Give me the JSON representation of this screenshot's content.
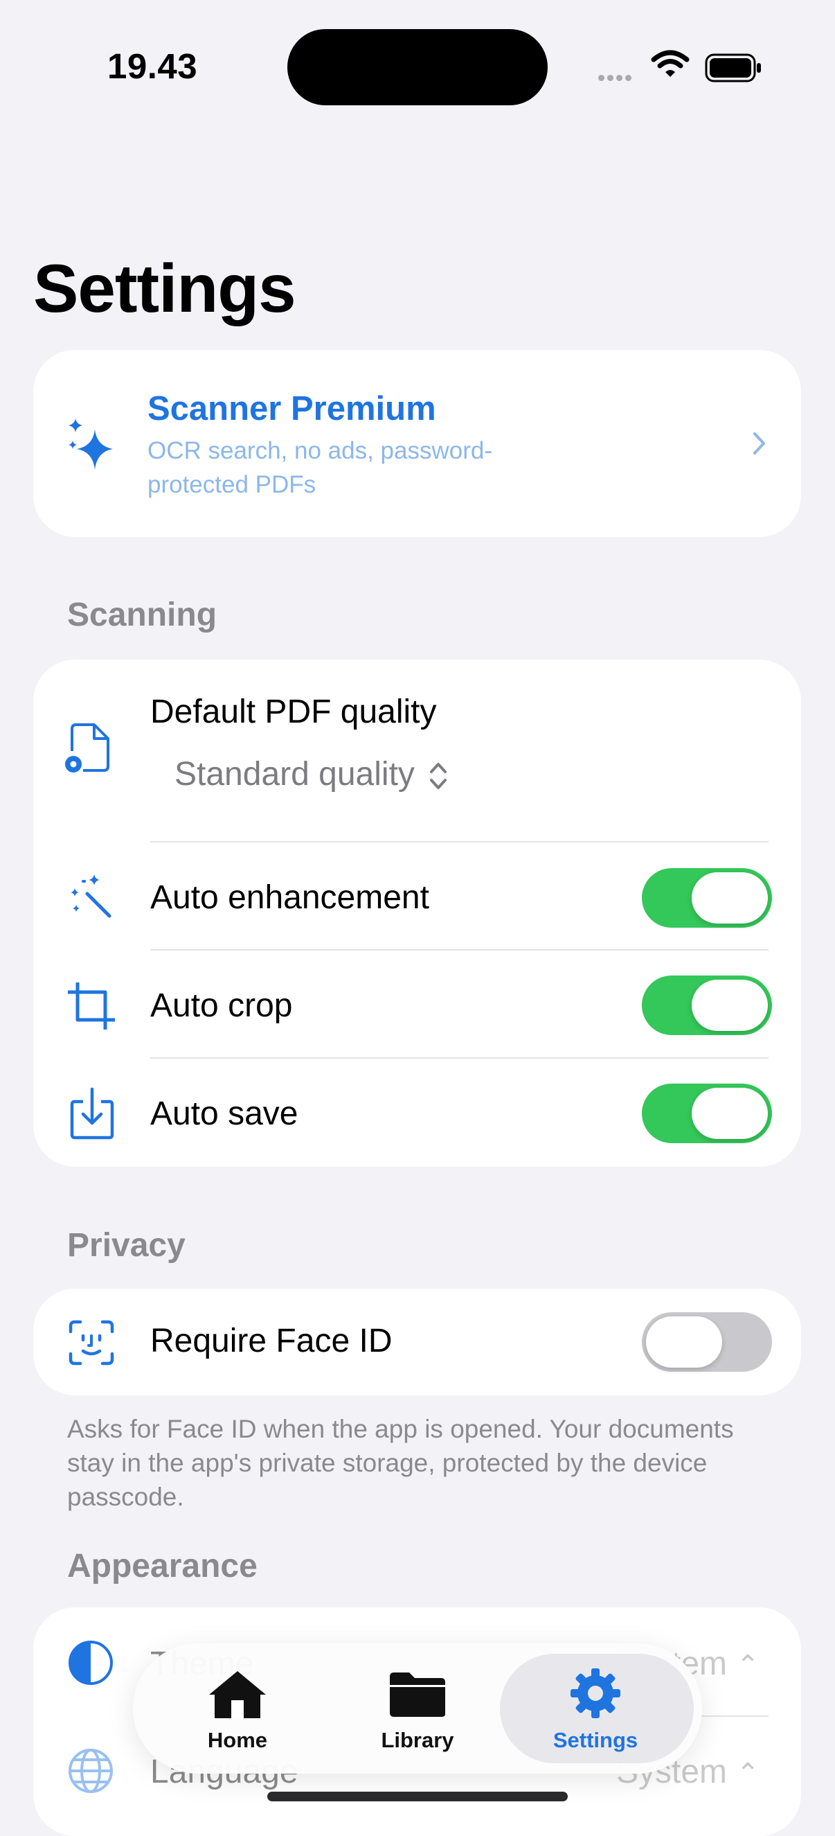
{
  "status_bar": {
    "time": "19.43"
  },
  "page": {
    "title": "Settings"
  },
  "premium": {
    "title": "Scanner Premium",
    "subtitle": "OCR search, no ads, password-protected PDFs",
    "icon": "sparkles-icon"
  },
  "scanning": {
    "header": "Scanning",
    "pdf_quality": {
      "label": "Default PDF quality",
      "value": "Standard quality"
    },
    "toggles": [
      {
        "label": "Auto enhancement",
        "on": true,
        "icon": "magic-wand-icon"
      },
      {
        "label": "Auto crop",
        "on": true,
        "icon": "crop-icon"
      },
      {
        "label": "Auto save",
        "on": true,
        "icon": "save-download-icon"
      }
    ]
  },
  "privacy": {
    "header": "Privacy",
    "face_id": {
      "label": "Require Face ID",
      "on": false
    },
    "footnote": "Asks for Face ID when the app is opened. Your documents stay in the app's private storage, protected by the device passcode."
  },
  "appearance": {
    "header": "Appearance",
    "theme": {
      "label": "Theme",
      "value": "System"
    },
    "language": {
      "label": "Language",
      "value": "System"
    }
  },
  "tab_bar": {
    "tabs": [
      {
        "label": "Home",
        "icon": "house-icon",
        "active": false
      },
      {
        "label": "Library",
        "icon": "folder-icon",
        "active": false
      },
      {
        "label": "Settings",
        "icon": "gear-icon",
        "active": true
      }
    ]
  },
  "colors": {
    "accent": "#1f74e0",
    "toggle_on": "#34c759",
    "background": "#f2f2f7"
  }
}
